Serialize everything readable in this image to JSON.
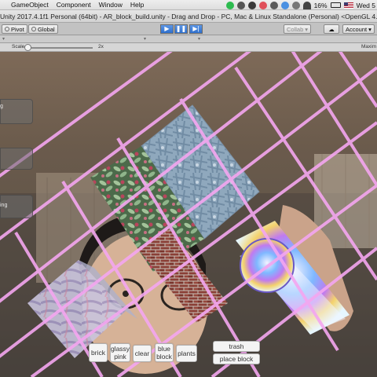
{
  "menubar": {
    "items": [
      "GameObject",
      "Component",
      "Window",
      "Help"
    ],
    "battery": "16%",
    "clock": "Wed 5",
    "tray_icons": [
      "wechat-icon",
      "camera-icon",
      "evernote-icon",
      "music-icon",
      "cloud-icon",
      "dropbox-icon",
      "sync-icon",
      "wifi-icon",
      "battery-icon",
      "flag-icon"
    ]
  },
  "window": {
    "title": "Unity 2017.4.1f1 Personal (64bit) - AR_block_build.unity - Drag and Drop - PC, Mac & Linux Standalone (Personal) <OpenGL 4.1>"
  },
  "toolbar": {
    "pivot_label": "Pivot",
    "global_label": "Global",
    "collab_label": "Collab",
    "account_label": "Account"
  },
  "scalebar": {
    "scale_label": "Scale",
    "scale_value": "2x",
    "maximize_label": "Maxim"
  },
  "block_buttons": [
    {
      "key": "brick",
      "label": "brick"
    },
    {
      "key": "glassy-pink",
      "label": "glassy\npink"
    },
    {
      "key": "clear",
      "label": "clear"
    },
    {
      "key": "blue-block",
      "label": "blue\nblock"
    },
    {
      "key": "plants",
      "label": "plants"
    }
  ],
  "actions": {
    "trash_label": "trash",
    "place_block_label": "place block"
  },
  "colors": {
    "grid": "#f4a6f0",
    "play_accent": "#3a7bd5"
  }
}
